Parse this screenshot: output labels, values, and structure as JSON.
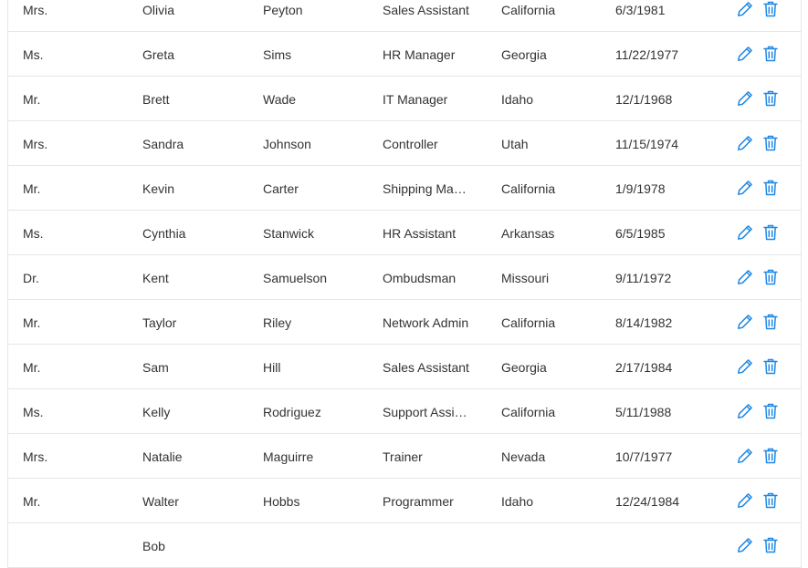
{
  "colors": {
    "accent": "#1e88e5",
    "border": "#e6e6e6",
    "text": "#333333"
  },
  "icons": {
    "edit": "pencil-icon",
    "delete": "trash-icon"
  },
  "rows": [
    {
      "prefix": "Mrs.",
      "first": "Olivia",
      "last": "Peyton",
      "position": "Sales Assistant",
      "state": "California",
      "birth": "6/3/1981"
    },
    {
      "prefix": "Ms.",
      "first": "Greta",
      "last": "Sims",
      "position": "HR Manager",
      "state": "Georgia",
      "birth": "11/22/1977"
    },
    {
      "prefix": "Mr.",
      "first": "Brett",
      "last": "Wade",
      "position": "IT Manager",
      "state": "Idaho",
      "birth": "12/1/1968"
    },
    {
      "prefix": "Mrs.",
      "first": "Sandra",
      "last": "Johnson",
      "position": "Controller",
      "state": "Utah",
      "birth": "11/15/1974"
    },
    {
      "prefix": "Mr.",
      "first": "Kevin",
      "last": "Carter",
      "position": "Shipping Ma…",
      "state": "California",
      "birth": "1/9/1978"
    },
    {
      "prefix": "Ms.",
      "first": "Cynthia",
      "last": "Stanwick",
      "position": "HR Assistant",
      "state": "Arkansas",
      "birth": "6/5/1985"
    },
    {
      "prefix": "Dr.",
      "first": "Kent",
      "last": "Samuelson",
      "position": "Ombudsman",
      "state": "Missouri",
      "birth": "9/11/1972"
    },
    {
      "prefix": "Mr.",
      "first": "Taylor",
      "last": "Riley",
      "position": "Network Admin",
      "state": "California",
      "birth": "8/14/1982"
    },
    {
      "prefix": "Mr.",
      "first": "Sam",
      "last": "Hill",
      "position": "Sales Assistant",
      "state": "Georgia",
      "birth": "2/17/1984"
    },
    {
      "prefix": "Ms.",
      "first": "Kelly",
      "last": "Rodriguez",
      "position": "Support Assi…",
      "state": "California",
      "birth": "5/11/1988"
    },
    {
      "prefix": "Mrs.",
      "first": "Natalie",
      "last": "Maguirre",
      "position": "Trainer",
      "state": "Nevada",
      "birth": "10/7/1977"
    },
    {
      "prefix": "Mr.",
      "first": "Walter",
      "last": "Hobbs",
      "position": "Programmer",
      "state": "Idaho",
      "birth": "12/24/1984"
    },
    {
      "prefix": "",
      "first": "Bob",
      "last": "",
      "position": "",
      "state": "",
      "birth": ""
    }
  ]
}
